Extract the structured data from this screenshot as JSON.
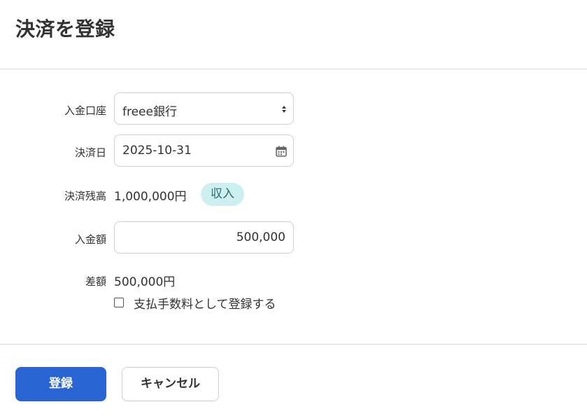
{
  "page": {
    "title": "決済を登録"
  },
  "form": {
    "account": {
      "label": "入金口座",
      "value": "freee銀行"
    },
    "settlement_date": {
      "label": "決済日",
      "value": "2025-10-31"
    },
    "settlement_balance": {
      "label": "決済残高",
      "value": "1,000,000円",
      "badge": "収入"
    },
    "deposit_amount": {
      "label": "入金額",
      "value": "500,000"
    },
    "difference": {
      "label": "差額",
      "value": "500,000円"
    },
    "fee_checkbox": {
      "label": "支払手数料として登録する",
      "checked": false
    }
  },
  "actions": {
    "submit_label": "登録",
    "cancel_label": "キャンセル"
  },
  "colors": {
    "primary": "#2864d2",
    "badge_bg": "#cdeff0",
    "badge_text": "#2e6c6e"
  },
  "icons": {
    "select": "select-arrows-icon",
    "date": "calendar-icon"
  }
}
